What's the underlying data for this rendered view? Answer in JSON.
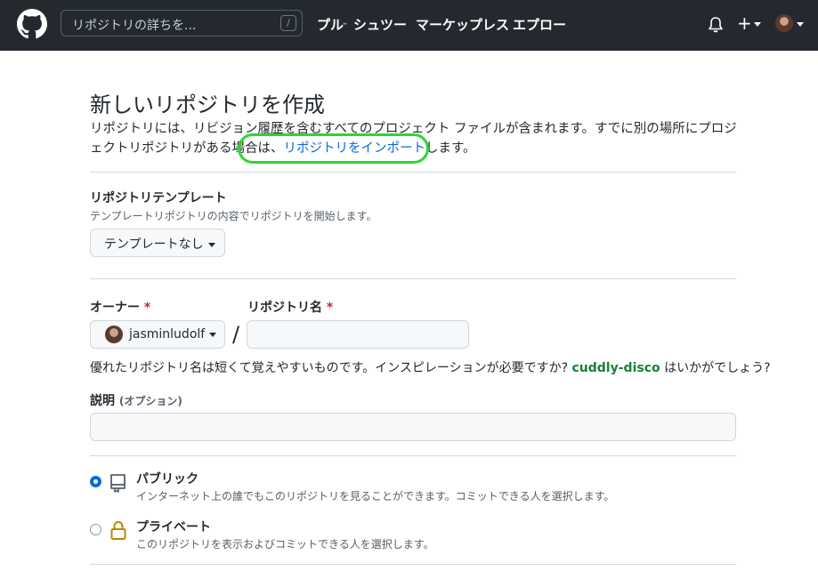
{
  "header": {
    "search_placeholder": "リポジトリの詳ちを...",
    "search_shortcut": "/",
    "nav": [
      "プル",
      "-",
      "シュツー",
      "マーケップレス",
      "エプロー"
    ],
    "new_menu_label": "+"
  },
  "page": {
    "title": "新しいリポジトリを作成",
    "intro_text": "リポジトリには、リビジョン履歴を含むすべてのプロジェクト ファイルが含まれます。すでに別の場所にプロジェクトリポジトリがある場合は、",
    "import_link": "リポジトリをインポート",
    "intro_suffix": "します。"
  },
  "template": {
    "label": "リポジトリテンプレート",
    "note": "テンプレートリポジトリの内容でリポジトリを開始します。",
    "selected": "テンプレートなし"
  },
  "owner": {
    "label": "オーナー",
    "required_mark": "*",
    "selected": "jasminludolf"
  },
  "repo_name": {
    "label": "リポジトリ名",
    "required_mark": "*",
    "separator": "/",
    "value": ""
  },
  "hint": {
    "text": "優れたリポジトリ名は短くて覚えやすいものです。インスピレーションが必要ですか? ",
    "suggestion": "cuddly-disco",
    "suffix": " はいかがでしょう?"
  },
  "description": {
    "label": "説明",
    "optional": "(オプション)",
    "value": ""
  },
  "visibility": {
    "selected": "public",
    "options": [
      {
        "title": "パブリック",
        "desc": "インターネット上の誰でもこのリポジトリを見ることができます。コミットできる人を選択します。",
        "icon": "repo-icon"
      },
      {
        "title": "プライベート",
        "desc": "このリポジトリを表示およびコミットできる人を選択します。",
        "icon": "lock-icon"
      }
    ]
  },
  "colors": {
    "header_bg": "#24292f",
    "link": "#0969da",
    "highlight": "#2bd632",
    "suggestion": "#1a7f37",
    "required": "#cf222e"
  }
}
